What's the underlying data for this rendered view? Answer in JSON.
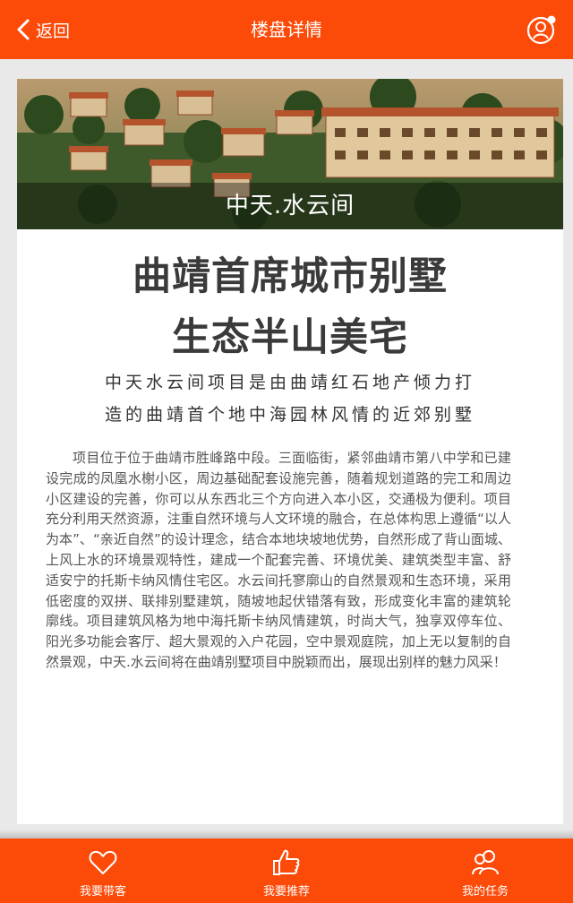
{
  "header": {
    "back_label": "返回",
    "title": "楼盘详情"
  },
  "banner": {
    "caption": "中天.水云间"
  },
  "headline": {
    "line1": "曲靖首席城市别墅",
    "line2": "生态半山美宅"
  },
  "subtitle": {
    "line1": "中天水云间项目是由曲靖红石地产倾力打",
    "line2": "造的曲靖首个地中海园林风情的近郊别墅"
  },
  "description": "项目位于位于曲靖市胜峰路中段。三面临街，紧邻曲靖市第八中学和已建设完成的凤凰水榭小区，周边基础配套设施完善，随着规划道路的完工和周边小区建设的完善，你可以从东西北三个方向进入本小区，交通极为便利。项目充分利用天然资源，注重自然环境与人文环境的融合，在总体构思上遵循“以人为本”、“亲近自然”的设计理念，结合本地块坡地优势，自然形成了背山面城、上风上水的环境景观特性，建成一个配套完善、环境优美、建筑类型丰富、舒适安宁的托斯卡纳风情住宅区。水云间托寥廓山的自然景观和生态环境，采用低密度的双拼、联排别墅建筑，随坡地起伏错落有致，形成变化丰富的建筑轮廓线。项目建筑风格为地中海托斯卡纳风情建筑，时尚大气，独享双停车位、阳光多功能会客厅、超大景观的入户花园，空中景观庭院，加上无以复制的自然景观，中天.水云间将在曲靖别墅项目中脱颖而出，展现出别样的魅力风采！",
  "footer": {
    "tabs": [
      {
        "label": "我要带客",
        "icon": "heart-icon"
      },
      {
        "label": "我要推荐",
        "icon": "thumbs-up-icon"
      },
      {
        "label": "我的任务",
        "icon": "users-icon"
      }
    ]
  },
  "colors": {
    "accent": "#fc4a09",
    "background": "#e9e9e9",
    "card": "#ffffff"
  }
}
